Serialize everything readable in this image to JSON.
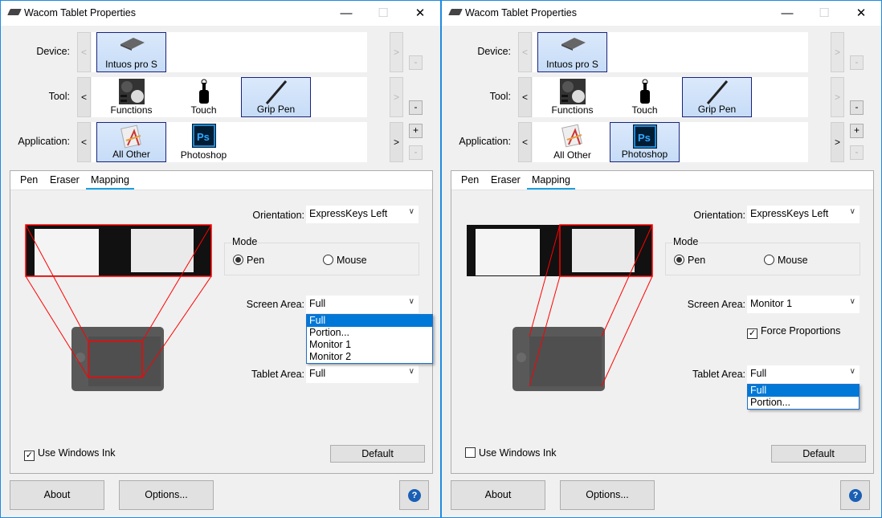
{
  "windows": [
    {
      "title": "Wacom Tablet Properties",
      "labels": {
        "device": "Device:",
        "tool": "Tool:",
        "application": "Application:"
      },
      "devices": [
        "Intuos pro S"
      ],
      "tools": [
        "Functions",
        "Touch",
        "Grip Pen"
      ],
      "selected_tool": "Grip Pen",
      "applications": [
        "All Other",
        "Photoshop"
      ],
      "selected_application": "All Other",
      "tabs": [
        "Pen",
        "Eraser",
        "Mapping"
      ],
      "active_tab": "Mapping",
      "orientation": {
        "label": "Orientation:",
        "value": "ExpressKeys Left"
      },
      "mode": {
        "title": "Mode",
        "pen": "Pen",
        "mouse": "Mouse",
        "selected": "Pen"
      },
      "screen_area": {
        "label": "Screen Area:",
        "value": "Full",
        "open": true,
        "options": [
          "Full",
          "Portion...",
          "Monitor 1",
          "Monitor 2"
        ],
        "highlighted": "Full"
      },
      "force_proportions": {
        "visible": false
      },
      "tablet_area": {
        "label": "Tablet Area:",
        "value": "Full",
        "open": false
      },
      "use_windows_ink": {
        "label": "Use Windows Ink",
        "checked": true
      },
      "default_button": "Default",
      "about_button": "About",
      "options_button": "Options...",
      "help_icon": "?"
    },
    {
      "title": "Wacom Tablet Properties",
      "labels": {
        "device": "Device:",
        "tool": "Tool:",
        "application": "Application:"
      },
      "devices": [
        "Intuos pro S"
      ],
      "tools": [
        "Functions",
        "Touch",
        "Grip Pen"
      ],
      "selected_tool": "Grip Pen",
      "applications": [
        "All Other",
        "Photoshop"
      ],
      "selected_application": "Photoshop",
      "tabs": [
        "Pen",
        "Eraser",
        "Mapping"
      ],
      "active_tab": "Mapping",
      "orientation": {
        "label": "Orientation:",
        "value": "ExpressKeys Left"
      },
      "mode": {
        "title": "Mode",
        "pen": "Pen",
        "mouse": "Mouse",
        "selected": "Pen"
      },
      "screen_area": {
        "label": "Screen Area:",
        "value": "Monitor 1",
        "open": false
      },
      "force_proportions": {
        "visible": true,
        "label": "Force Proportions",
        "checked": true
      },
      "tablet_area": {
        "label": "Tablet Area:",
        "value": "Full",
        "open": true,
        "options": [
          "Full",
          "Portion..."
        ],
        "highlighted": "Full"
      },
      "use_windows_ink": {
        "label": "Use Windows Ink",
        "checked": false
      },
      "default_button": "Default",
      "about_button": "About",
      "options_button": "Options...",
      "help_icon": "?"
    }
  ]
}
